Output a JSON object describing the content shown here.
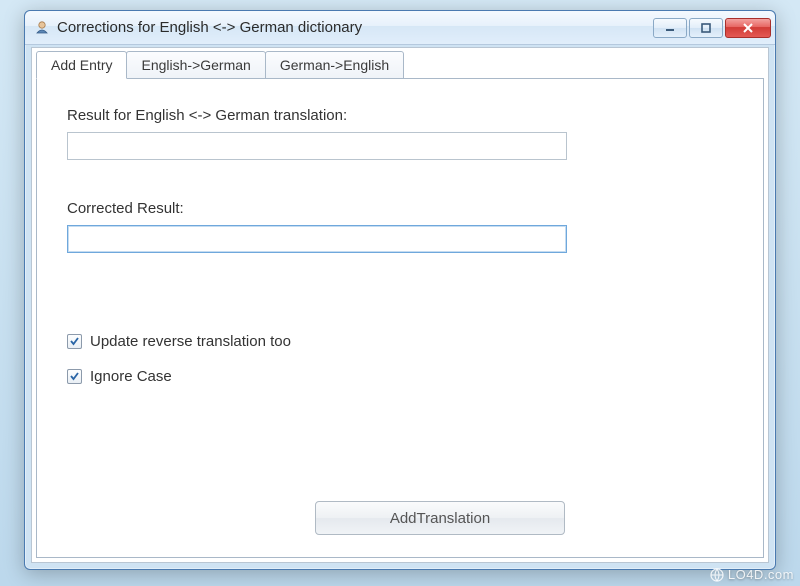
{
  "window": {
    "title": "Corrections for English <-> German dictionary"
  },
  "tabs": [
    {
      "label": "Add Entry",
      "active": true
    },
    {
      "label": "English->German",
      "active": false
    },
    {
      "label": "German->English",
      "active": false
    }
  ],
  "fields": {
    "result_label": "Result for English <-> German translation:",
    "result_value": "",
    "corrected_label": "Corrected Result:",
    "corrected_value": ""
  },
  "checkboxes": {
    "update_reverse": {
      "label": "Update reverse translation too",
      "checked": true
    },
    "ignore_case": {
      "label": "Ignore Case",
      "checked": true
    }
  },
  "buttons": {
    "add_translation": "AddTranslation"
  },
  "watermark": "LO4D.com"
}
